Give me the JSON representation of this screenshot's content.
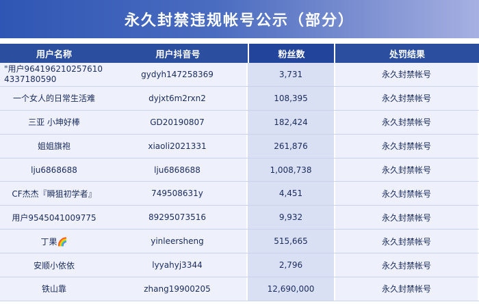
{
  "banner": {
    "title": "永久封禁违规帐号公示（部分）"
  },
  "table": {
    "headers": {
      "user_name": "用户名称",
      "douyin_id": "用户抖音号",
      "followers": "粉丝数",
      "result": "处罚结果"
    },
    "rows": [
      {
        "user_name": "\"用户9641962102576104337180590",
        "douyin_id": "gydyh147258369",
        "followers": "3,731",
        "result": "永久封禁帐号"
      },
      {
        "user_name": "一个女人的日常生活难",
        "douyin_id": "dyjxt6m2rxn2",
        "followers": "108,395",
        "result": "永久封禁帐号"
      },
      {
        "user_name": "三亚 小坤好棒",
        "douyin_id": "GD20190807",
        "followers": "182,424",
        "result": "永久封禁帐号"
      },
      {
        "user_name": "姐姐旗袍",
        "douyin_id": "xiaoli2021331",
        "followers": "261,876",
        "result": "永久封禁帐号"
      },
      {
        "user_name": "lju6868688",
        "douyin_id": "lju6868688",
        "followers": "1,008,738",
        "result": "永久封禁帐号"
      },
      {
        "user_name": "CF杰杰『瞬狙初学者』",
        "douyin_id": "749508631y",
        "followers": "4,451",
        "result": "永久封禁帐号"
      },
      {
        "user_name": "用户9545041009775",
        "douyin_id": "89295073516",
        "followers": "9,932",
        "result": "永久封禁帐号"
      },
      {
        "user_name": "丁果🌈",
        "douyin_id": "yinleersheng",
        "followers": "515,665",
        "result": "永久封禁帐号"
      },
      {
        "user_name": "安顺小依依",
        "douyin_id": "lyyahyj3344",
        "followers": "2,796",
        "result": "永久封禁帐号"
      },
      {
        "user_name": "铁山靠",
        "douyin_id": "zhang19900205",
        "followers": "12,690,000",
        "result": "永久封禁帐号"
      }
    ]
  }
}
